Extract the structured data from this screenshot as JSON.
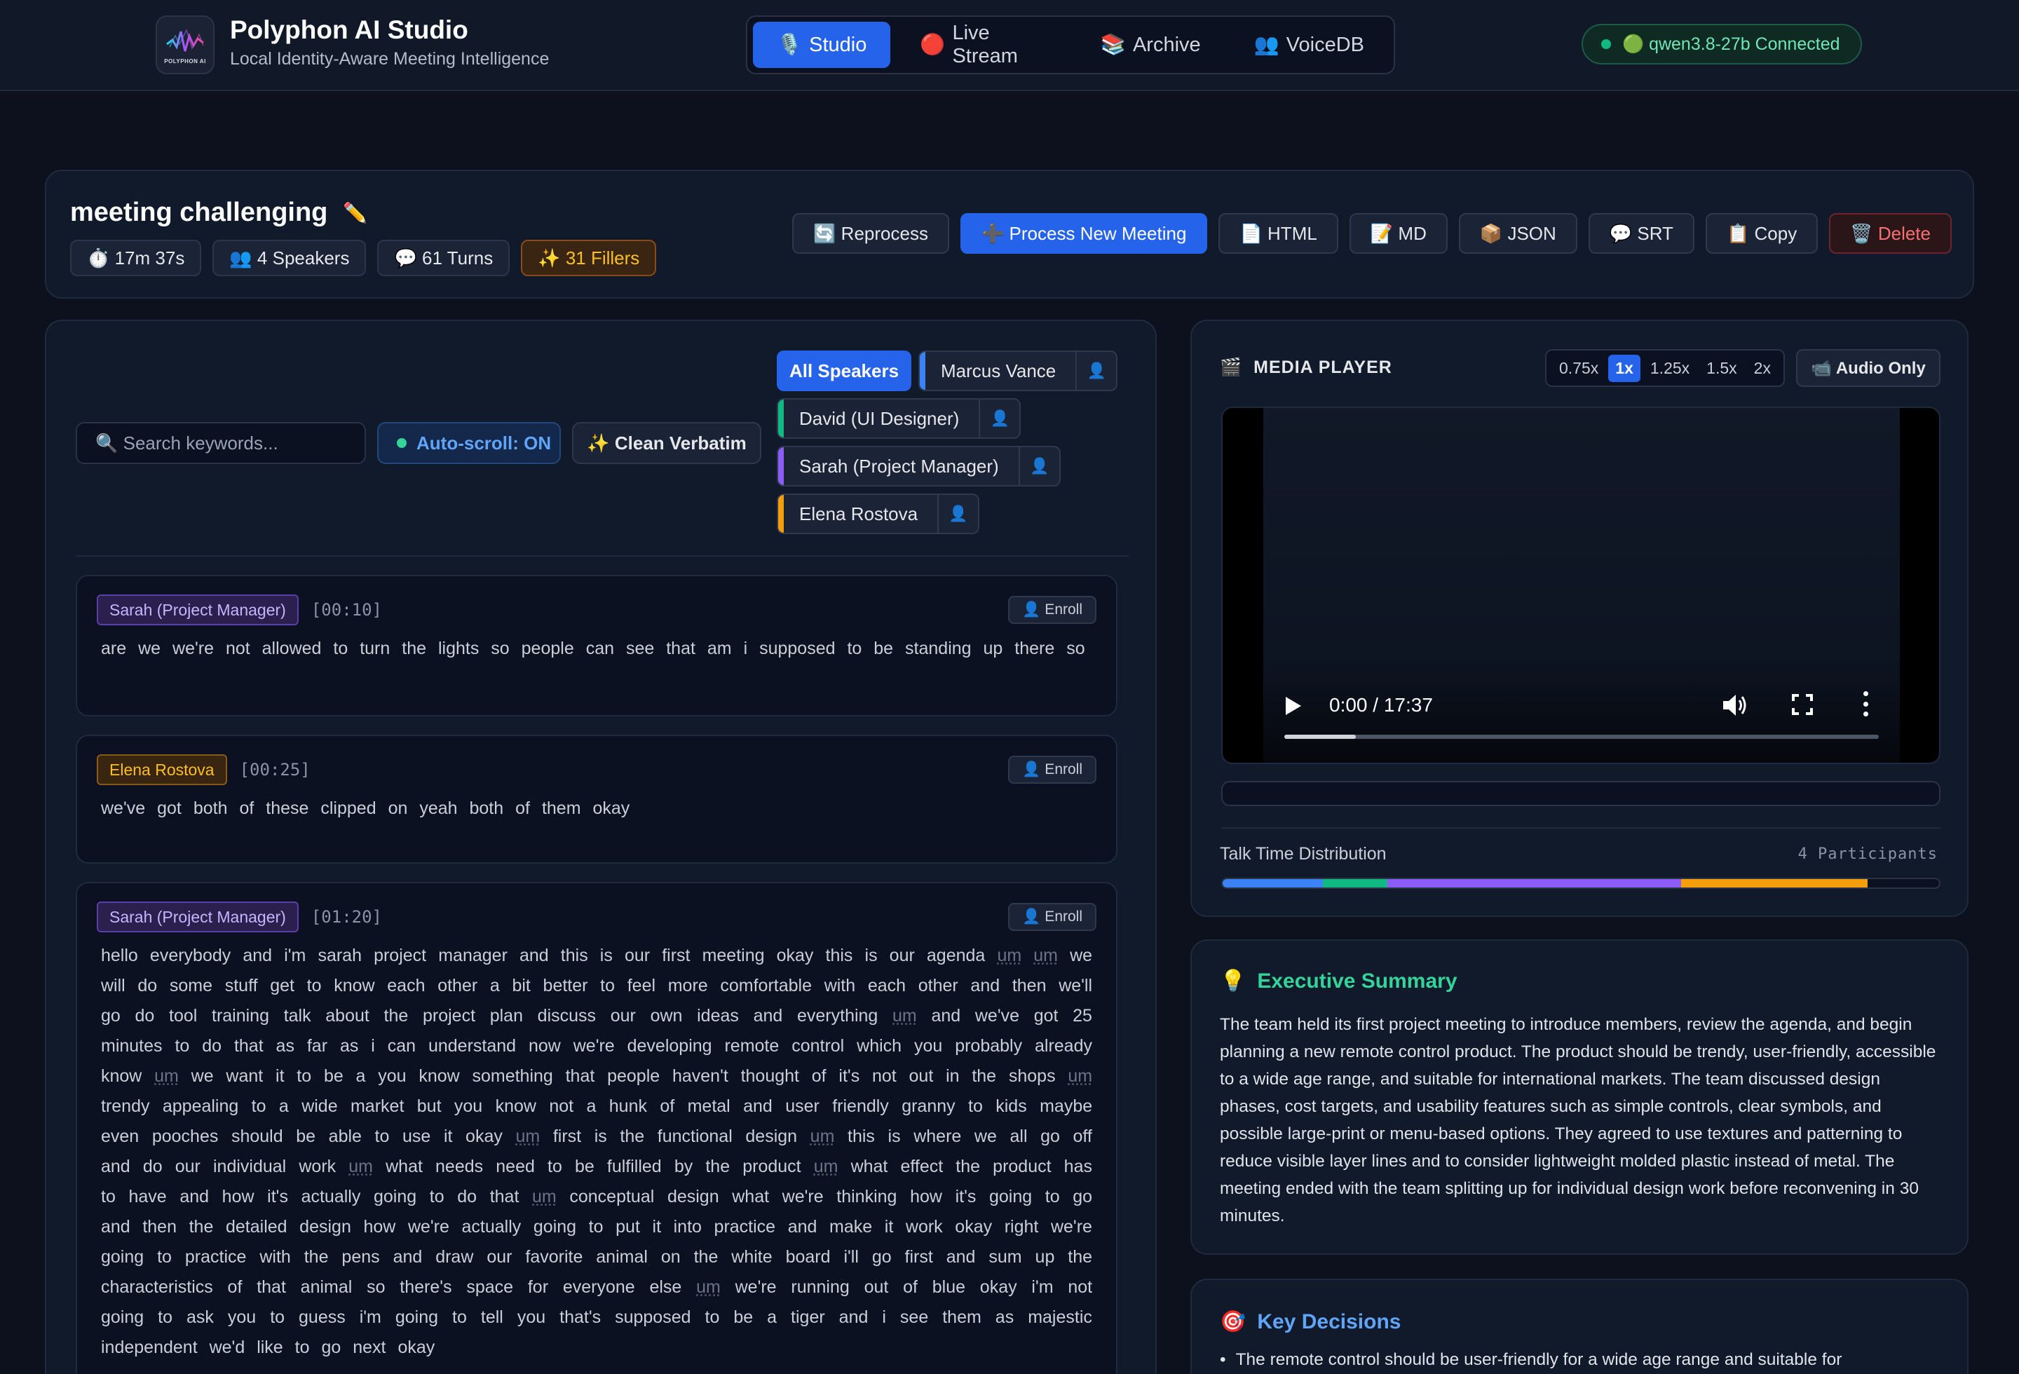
{
  "app": {
    "title": "Polyphon AI Studio",
    "subtitle": "Local Identity-Aware Meeting Intelligence",
    "logo_text": "POLYPHON AI"
  },
  "nav": {
    "tabs": [
      {
        "icon": "🎙️",
        "label": "Studio",
        "active": true
      },
      {
        "icon": "🔴",
        "label": "Live Stream",
        "active": false
      },
      {
        "icon": "📚",
        "label": "Archive",
        "active": false
      },
      {
        "icon": "👥",
        "label": "VoiceDB",
        "active": false
      }
    ]
  },
  "connection": {
    "label": "🟢 qwen3.8-27b Connected",
    "status_color": "#10b981"
  },
  "meeting": {
    "title": "meeting challenging",
    "edit_icon": "✏️",
    "stats": {
      "duration": "⏱️ 17m 37s",
      "speakers": "👥 4 Speakers",
      "turns": "💬 61 Turns",
      "fillers": "✨ 31 Fillers"
    },
    "actions": {
      "reprocess": "🔄 Reprocess",
      "process_new": "➕ Process New Meeting",
      "html": "📄 HTML",
      "md": "📝 MD",
      "json": "📦 JSON",
      "srt": "💬 SRT",
      "copy": "📋 Copy",
      "delete": "🗑️ Delete"
    }
  },
  "transcript": {
    "search_placeholder": "🔍 Search keywords...",
    "auto_scroll": "Auto-scroll: ON",
    "clean_verbatim": "✨ Clean Verbatim",
    "all_speakers": "All Speakers",
    "speakers": [
      {
        "name": "Marcus Vance",
        "color": "#3b82f6"
      },
      {
        "name": "David (UI Designer)",
        "color": "#10b981"
      },
      {
        "name": "Sarah (Project Manager)",
        "color": "#8b5cf6"
      },
      {
        "name": "Elena Rostova",
        "color": "#f59e0b"
      }
    ],
    "enroll_icon": "👤",
    "enroll_label": "👤 Enroll",
    "segments": [
      {
        "speaker": "Sarah (Project Manager)",
        "time": "[00:10]",
        "text": "are we we're not allowed to turn the lights so people can see that am i supposed to be standing up there so"
      },
      {
        "speaker": "Elena Rostova",
        "time": "[00:25]",
        "text": "we've got both of these clipped on yeah both of them okay"
      },
      {
        "speaker": "Sarah (Project Manager)",
        "time": "[01:20]",
        "text": "hello everybody and i'm sarah project manager and this is our first meeting okay this is our agenda um um we will do some stuff get to know each other a bit better to feel more comfortable with each other and then we'll go do tool training talk about the project plan discuss our own ideas and everything um and we've got 25 minutes to do that as far as i can understand now we're developing remote control which you probably already know um we want it to be a you know something that people haven't thought of it's not out in the shops um trendy appealing to a wide market but you know not a hunk of metal and user friendly granny to kids maybe even pooches should be able to use it okay um first is the functional design um this is where we all go off and do our individual work um what needs need to be fulfilled by the product um what effect the product has to have and how it's actually going to do that um conceptual design what we're thinking how it's going to go and then the detailed design how we're actually going to put it into practice and make it work okay right we're going to practice with the pens and draw our favorite animal on the white board i'll go first and sum up the characteristics of that animal so there's space for everyone else um we're running out of blue okay i'm not going to ask you to guess i'm going to tell you that's supposed to be a tiger and i see them as majestic independent we'd like to go next okay"
      }
    ]
  },
  "media": {
    "title": "MEDIA PLAYER",
    "title_icon": "🎬",
    "speeds": [
      "0.75x",
      "1x",
      "1.25x",
      "1.5x",
      "2x"
    ],
    "active_speed": "1x",
    "audio_only": "📹 Audio Only",
    "time_display": "0:00 / 17:37",
    "progress": 0.12,
    "talk_time_label": "Talk Time Distribution",
    "participants_label": "4 Participants",
    "talk_share": [
      {
        "speaker": "Marcus Vance",
        "fraction": 0.14,
        "color": "#3b82f6"
      },
      {
        "speaker": "David (UI Designer)",
        "fraction": 0.09,
        "color": "#10b981"
      },
      {
        "speaker": "Sarah (Project Manager)",
        "fraction": 0.41,
        "color": "#8b5cf6"
      },
      {
        "speaker": "Elena Rostova",
        "fraction": 0.26,
        "color": "#f59e0b"
      }
    ]
  },
  "summary": {
    "icon": "💡",
    "title": "Executive Summary",
    "text": "The team held its first project meeting to introduce members, review the agenda, and begin planning a new remote control product. The product should be trendy, user-friendly, accessible to a wide age range, and suitable for international markets. The team discussed design phases, cost targets, and usability features such as simple controls, clear symbols, and possible large-print or menu-based options. They agreed to use textures and patterning to reduce visible layer lines and to consider lightweight molded plastic instead of metal. The meeting ended with the team splitting up for individual design work before reconvening in 30 minutes."
  },
  "decisions": {
    "icon": "🎯",
    "title": "Key Decisions",
    "items": [
      "The remote control should be user-friendly for a wide age range and suitable for"
    ]
  }
}
